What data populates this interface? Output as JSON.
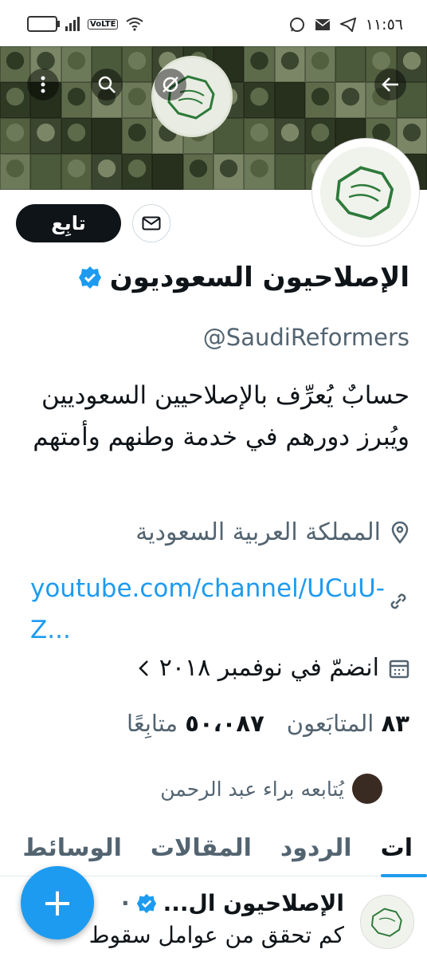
{
  "status_bar": {
    "time": "١١:٥٦",
    "battery": "",
    "network": "VoLTE",
    "icons": [
      "battery-icon",
      "signal-icon",
      "volte-icon",
      "wifi-icon",
      "telegram-icon",
      "mail-icon",
      "whatsapp-icon"
    ]
  },
  "header": {
    "back_icon": "arrow-left-icon",
    "hide_icon": "eye-off-icon",
    "search_icon": "search-icon",
    "more_icon": "more-vertical-icon"
  },
  "actions": {
    "follow_label": "تابِع",
    "message_icon": "mail-icon"
  },
  "profile": {
    "name": "الإصلاحيون السعوديون",
    "verified": true,
    "handle": "@SaudiReformers",
    "bio": "حسابٌ يُعرِّف بالإصلاحيين السعوديين ويُبرز دورهم في خدمة وطنهم وأمتهم",
    "location": "المملكة العربية السعودية",
    "link": "youtube.com/channel/UCuU-Z...",
    "joined": "انضمّ في نوفمبر ٢٠١٨",
    "following_count": "٨٣",
    "following_label": "المتابَعون",
    "followers_count": "٥٠،٠٨٧",
    "followers_label": "متابِعًا",
    "followed_by": "يُتابعه براء عبد الرحمن"
  },
  "tabs": [
    {
      "label": "ات",
      "active": true
    },
    {
      "label": "الردود",
      "active": false
    },
    {
      "label": "المقالات",
      "active": false
    },
    {
      "label": "الوسائط",
      "active": false
    }
  ],
  "tweet": {
    "name": "الإصلاحيون ال...",
    "dot": "·",
    "text": "كم تحقق من عوامل سقوط"
  },
  "fab": {
    "label": "+"
  },
  "colors": {
    "accent": "#1d9bf0",
    "text": "#0f1419",
    "muted": "#536471"
  }
}
